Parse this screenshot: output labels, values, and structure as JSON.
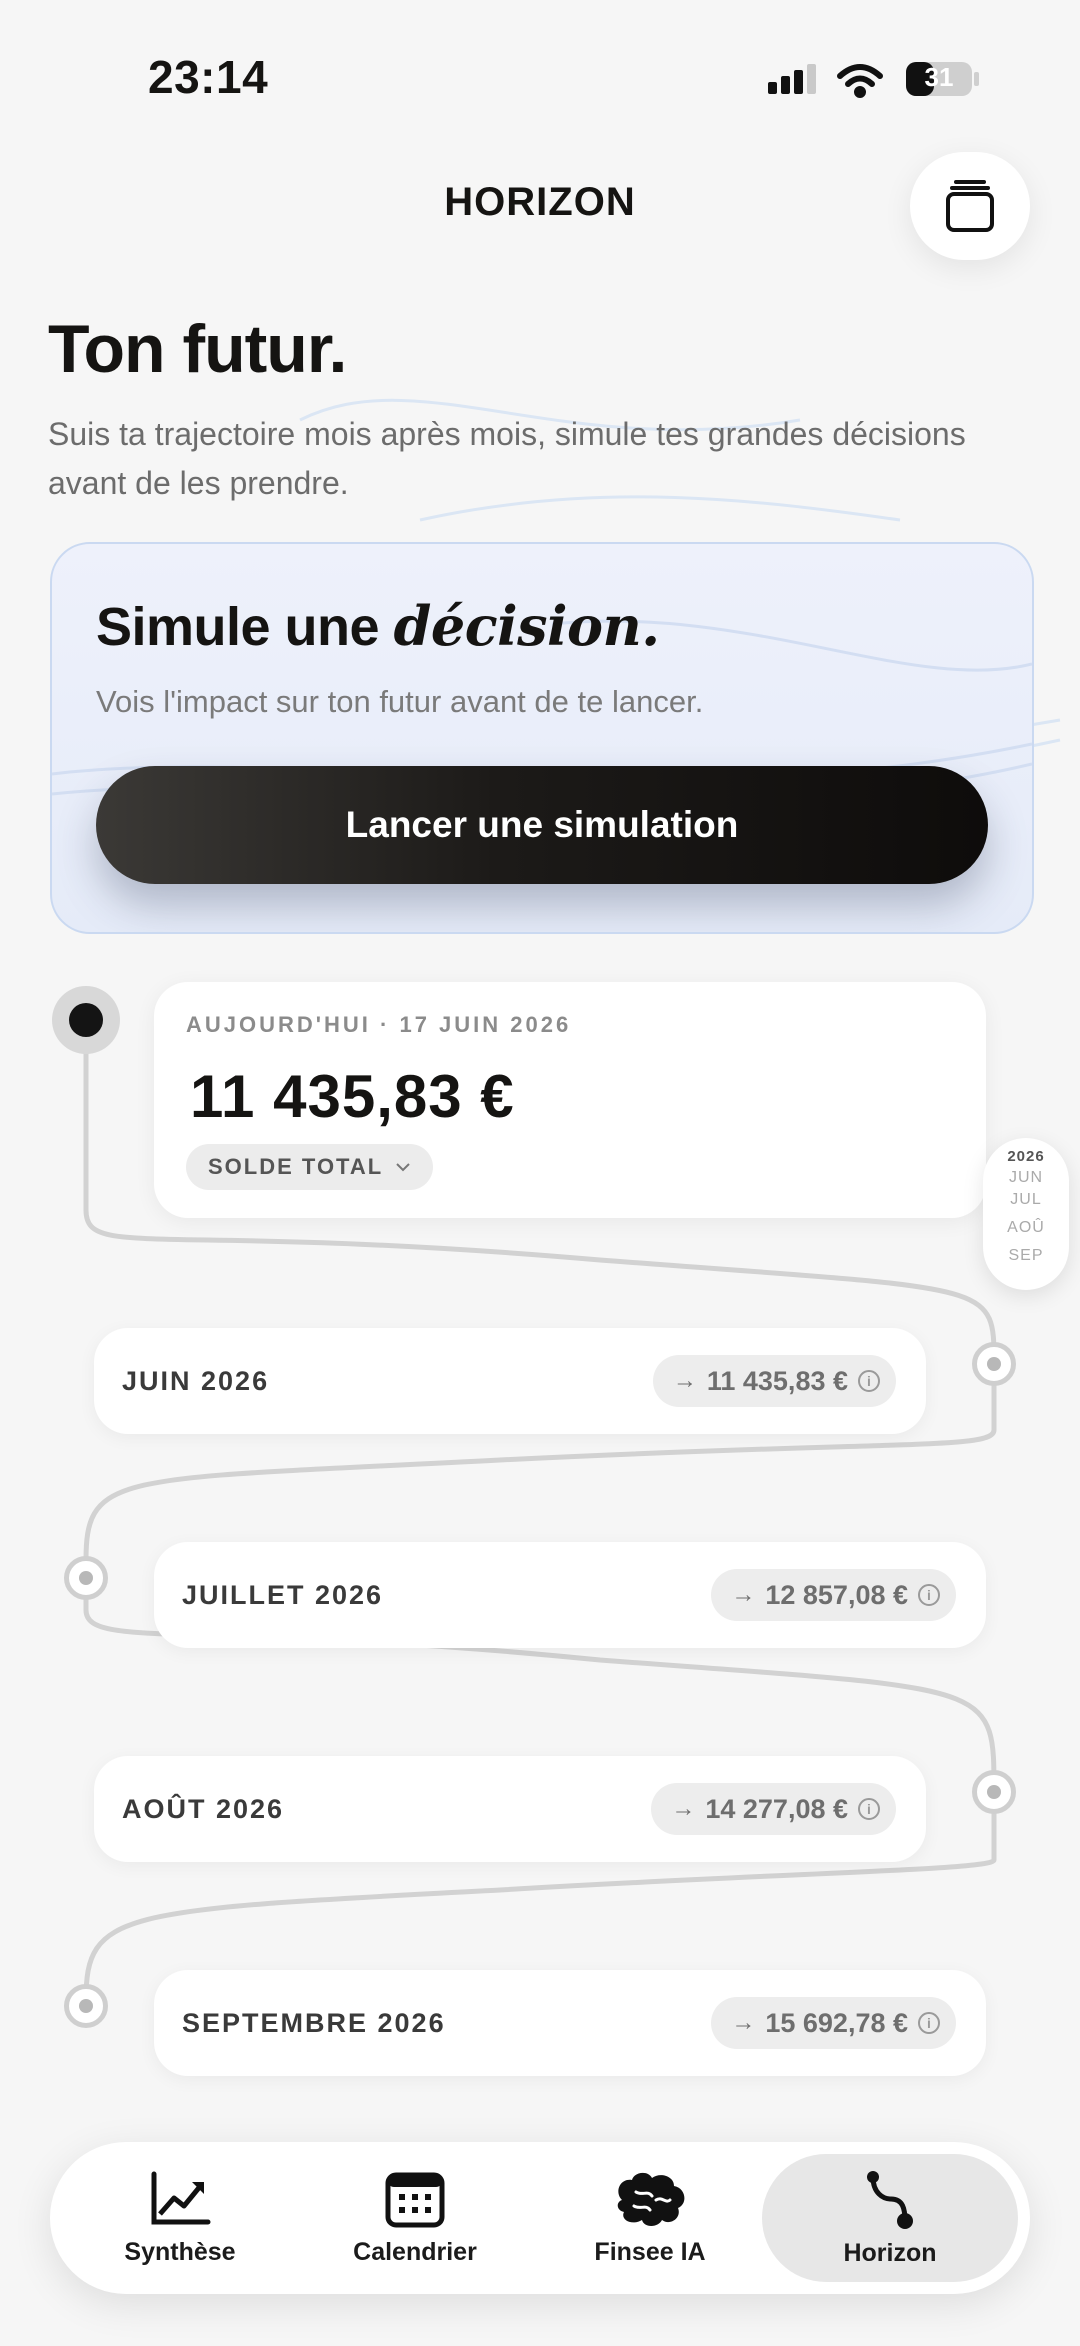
{
  "status_bar": {
    "time": "23:14",
    "battery": "31"
  },
  "header": {
    "title": "HORIZON"
  },
  "hero": {
    "title": "Ton futur.",
    "subtitle": "Suis ta trajectoire mois après mois, simule tes grandes décisions avant de les prendre."
  },
  "simulate_card": {
    "title_prefix": "Simule une ",
    "title_emphasis": "décision.",
    "subtitle": "Vois l'impact sur ton futur avant de te lancer.",
    "button_label": "Lancer une simulation"
  },
  "today": {
    "label": "AUJOURD'HUI · 17 JUIN 2026",
    "amount": "11 435,83 €",
    "balance_pill": "SOLDE TOTAL"
  },
  "months": [
    {
      "name": "JUIN 2026",
      "amount": "11 435,83 €"
    },
    {
      "name": "JUILLET 2026",
      "amount": "12 857,08 €"
    },
    {
      "name": "AOÛT 2026",
      "amount": "14 277,08 €"
    },
    {
      "name": "SEPTEMBRE 2026",
      "amount": "15 692,78 €"
    }
  ],
  "month_scroller": {
    "year": "2026",
    "items": [
      "JUN",
      "JUL",
      "AOÛ",
      "SEP"
    ]
  },
  "bottom_nav": {
    "items": [
      {
        "label": "Synthèse",
        "icon": "chart-trend-icon"
      },
      {
        "label": "Calendrier",
        "icon": "calendar-icon"
      },
      {
        "label": "Finsee IA",
        "icon": "brain-icon"
      },
      {
        "label": "Horizon",
        "icon": "path-icon",
        "active": true
      }
    ]
  },
  "colors": {
    "accent_dark": "#151412",
    "card_border": "#cad9f1",
    "background": "#f6f6f6"
  }
}
